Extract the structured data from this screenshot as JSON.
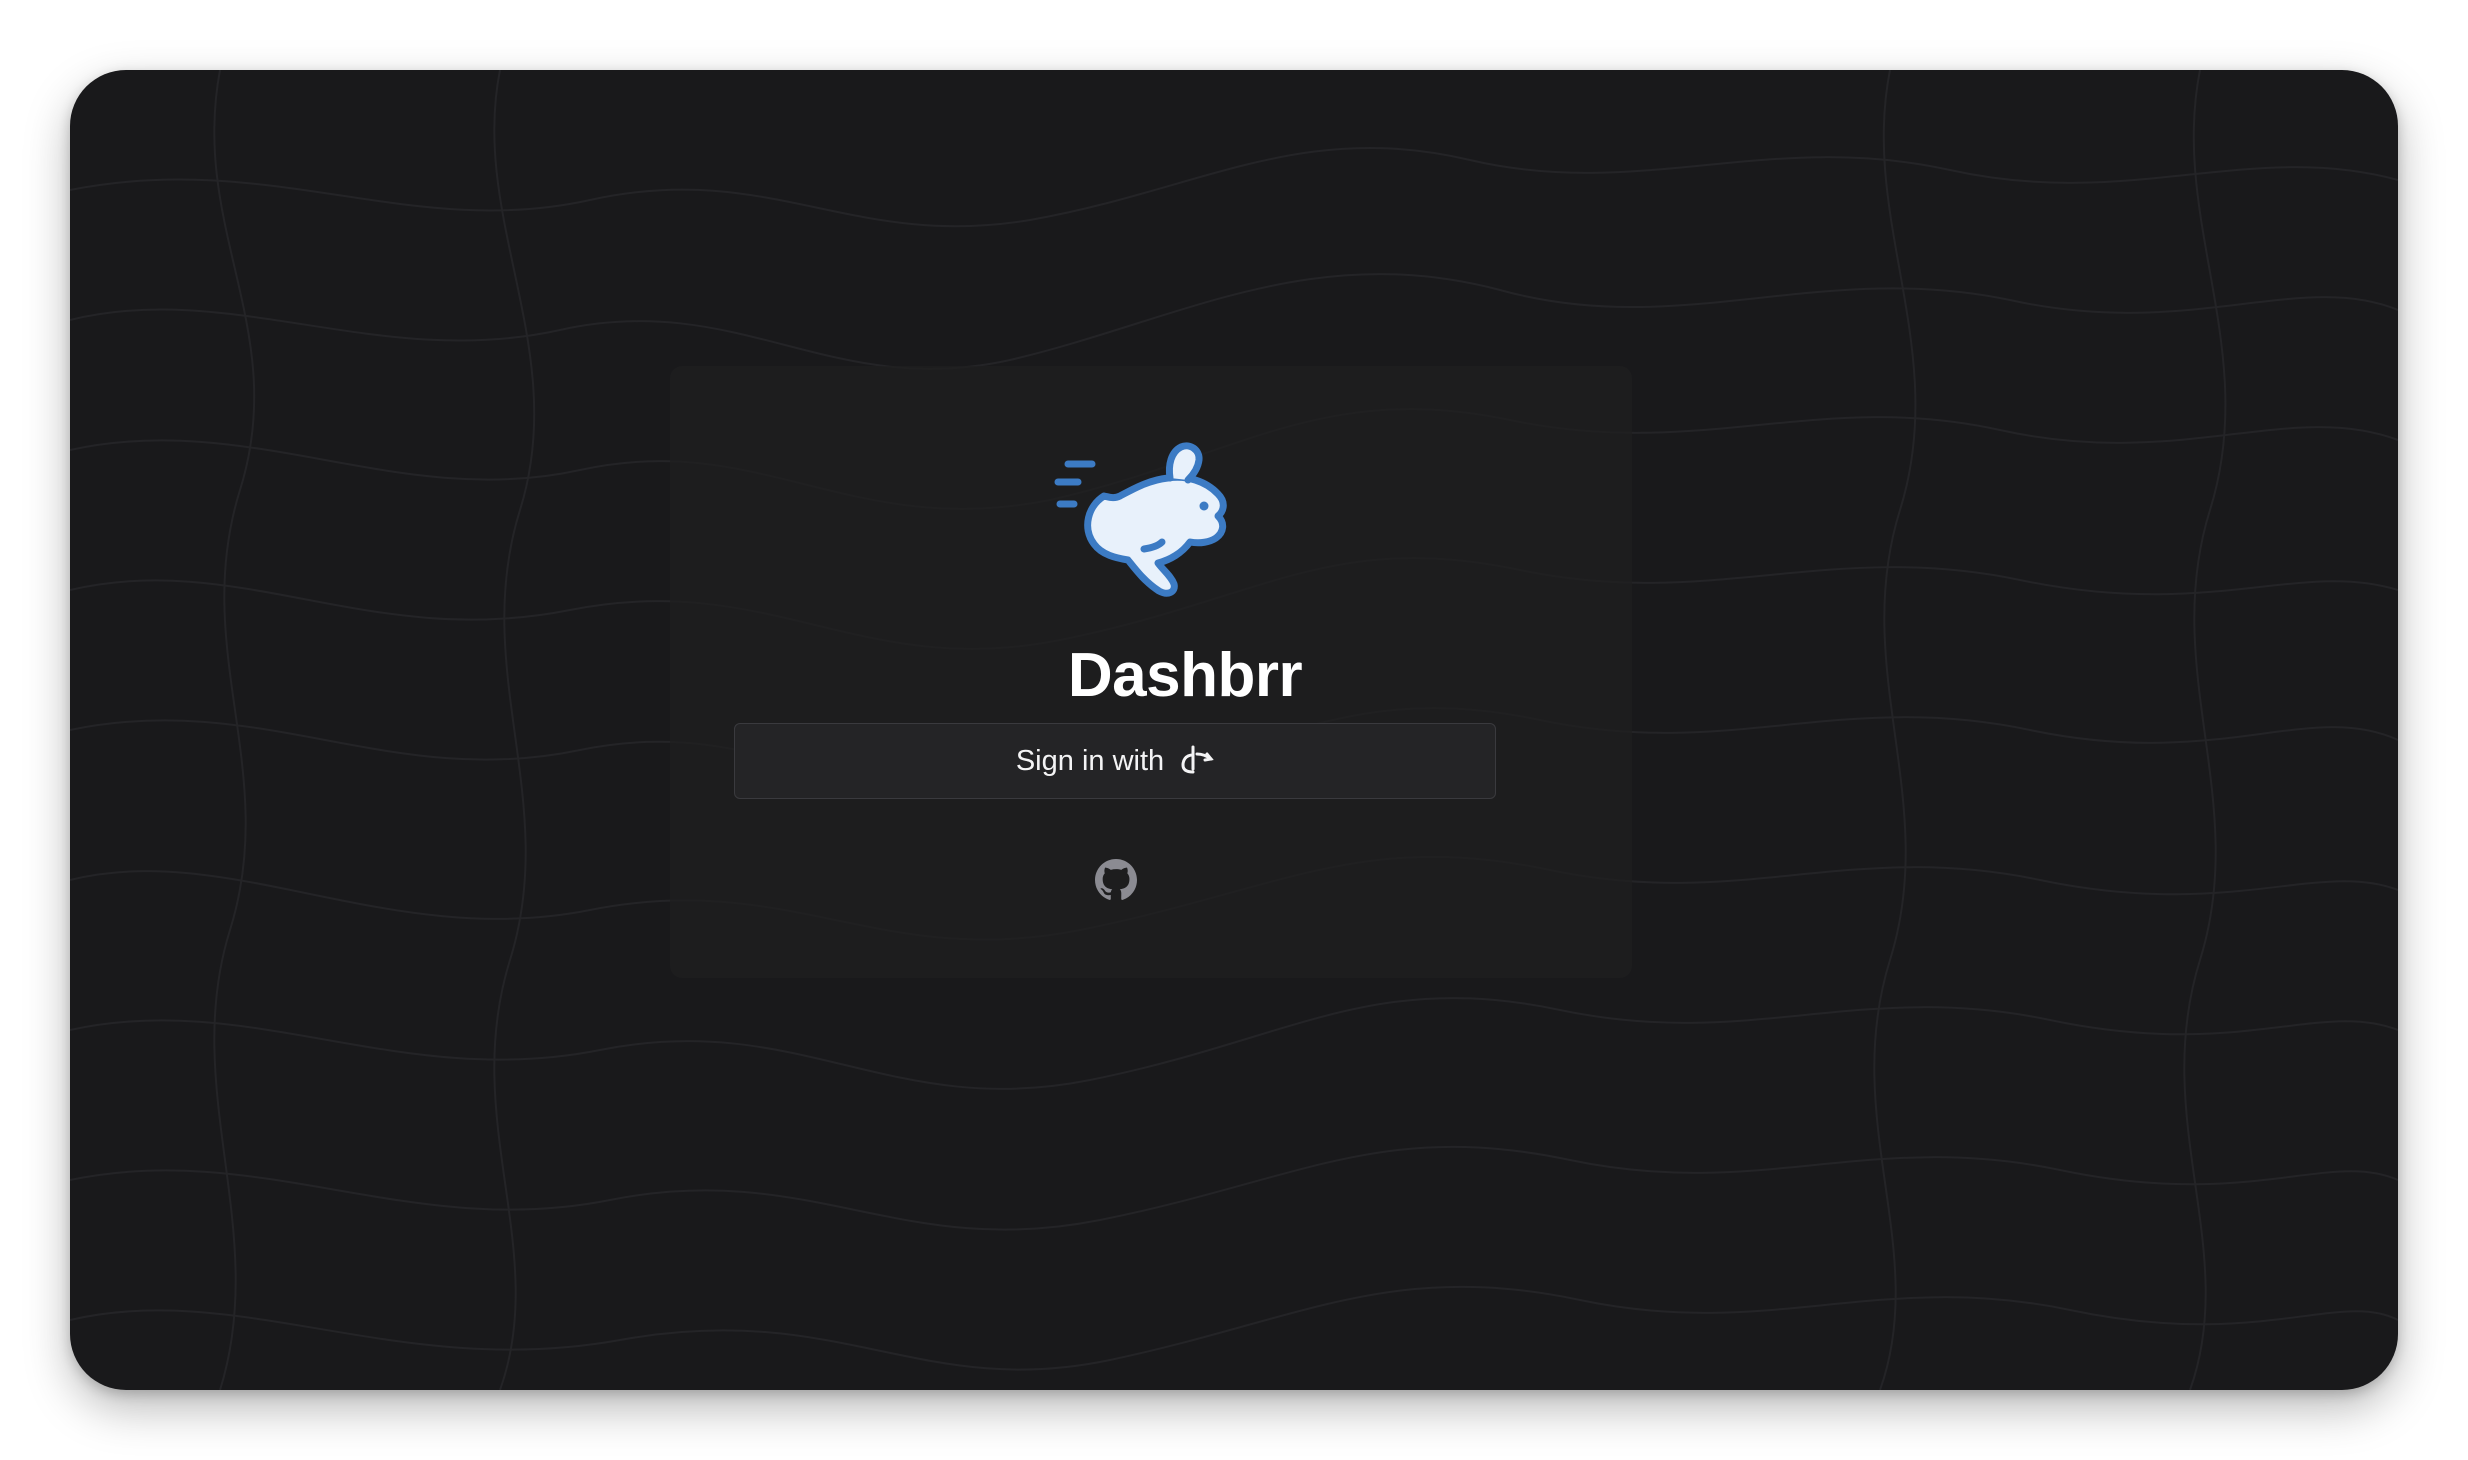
{
  "app": {
    "title": "Dashbrr"
  },
  "login": {
    "signin_label": "Sign in with",
    "provider_icon": "oidc-icon",
    "logo_icon": "rabbit-logo-icon",
    "footer_link_icon": "github-icon"
  },
  "colors": {
    "background": "#19191b",
    "card": "#1e1e20",
    "button_bg": "#242426",
    "button_border": "#3a3a3e",
    "text": "#ffffff",
    "logo_fill": "#e8f1fb",
    "logo_outline": "#3c7bc4",
    "icon_gray": "#8b8b92"
  }
}
